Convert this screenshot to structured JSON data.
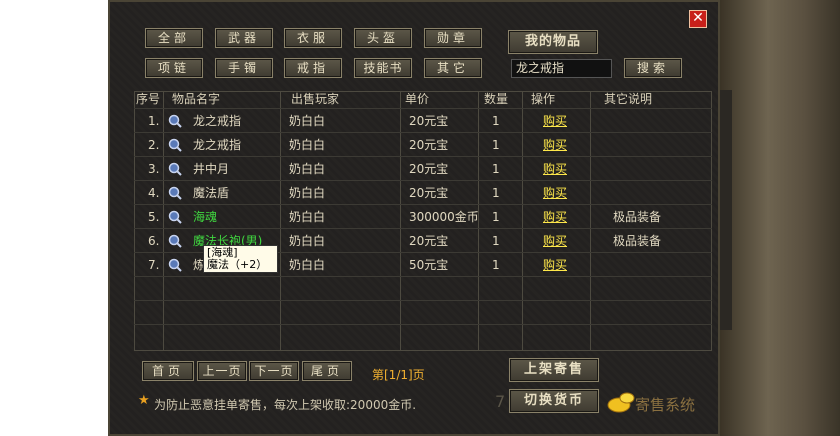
{
  "close_label": "✕",
  "categories_row1": [
    "全部",
    "武器",
    "衣服",
    "头盔",
    "勋章"
  ],
  "categories_row2": [
    "项链",
    "手镯",
    "戒指",
    "技能书",
    "其它"
  ],
  "my_items_label": "我的物品",
  "search_value": "龙之戒指",
  "search_label": "搜索",
  "columns": [
    "序号",
    "物品名字",
    "出售玩家",
    "单价",
    "数量",
    "操作",
    "其它说明"
  ],
  "rows": [
    {
      "no": "1.",
      "name": "龙之戒指",
      "seller": "奶白白",
      "price": "20元宝",
      "qty": "1",
      "action": "购买",
      "note": "",
      "color": "#e0d8c0"
    },
    {
      "no": "2.",
      "name": "龙之戒指",
      "seller": "奶白白",
      "price": "20元宝",
      "qty": "1",
      "action": "购买",
      "note": "",
      "color": "#e0d8c0"
    },
    {
      "no": "3.",
      "name": "井中月",
      "seller": "奶白白",
      "price": "20元宝",
      "qty": "1",
      "action": "购买",
      "note": "",
      "color": "#e0d8c0"
    },
    {
      "no": "4.",
      "name": "魔法盾",
      "seller": "奶白白",
      "price": "20元宝",
      "qty": "1",
      "action": "购买",
      "note": "",
      "color": "#e0d8c0"
    },
    {
      "no": "5.",
      "name": "海魂",
      "seller": "奶白白",
      "price": "300000金币",
      "qty": "1",
      "action": "购买",
      "note": "极品装备",
      "color": "#40d840"
    },
    {
      "no": "6.",
      "name": "魔法长袍(男)",
      "seller": "奶白白",
      "price": "20元宝",
      "qty": "1",
      "action": "购买",
      "note": "极品装备",
      "color": "#40d840"
    },
    {
      "no": "7.",
      "name": "炼",
      "seller": "奶白白",
      "price": "50元宝",
      "qty": "1",
      "action": "购买",
      "note": "",
      "color": "#e0d8c0"
    }
  ],
  "tooltip": {
    "line1": "[海魂]",
    "line2": "魔法（+2）"
  },
  "pager": {
    "first": "首页",
    "prev": "上一页",
    "next": "下一页",
    "last": "尾页",
    "info": "第[1/1]页"
  },
  "list_button": "上架寄售",
  "switch_currency": "切换货币",
  "notice": "为防止恶意挂单寄售，每次上架收取:20000金币.",
  "logo_text": "寄售系统",
  "logo_number": "7"
}
